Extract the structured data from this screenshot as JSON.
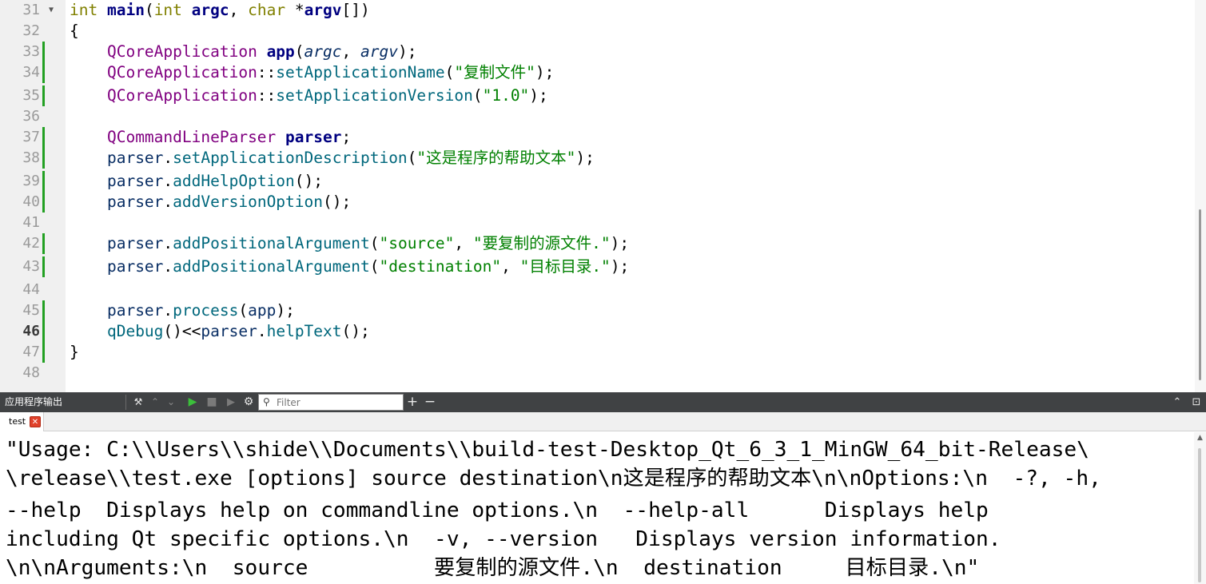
{
  "editor": {
    "lines": [
      {
        "n": "31",
        "fold": true,
        "segs": [
          [
            "int ",
            "k"
          ],
          [
            "main",
            "b"
          ],
          [
            "(",
            "p"
          ],
          [
            "int ",
            "k"
          ],
          [
            "argc",
            "b"
          ],
          [
            ", ",
            "p"
          ],
          [
            "char ",
            "k"
          ],
          [
            "*",
            "p"
          ],
          [
            "argv",
            "b"
          ],
          [
            "[])",
            "p"
          ]
        ]
      },
      {
        "n": "32",
        "segs": [
          [
            "{",
            "p"
          ]
        ]
      },
      {
        "n": "33",
        "changed": true,
        "segs": [
          [
            "    ",
            "p"
          ],
          [
            "QCoreApplication",
            "t"
          ],
          [
            " ",
            "p"
          ],
          [
            "app",
            "b"
          ],
          [
            "(",
            "p"
          ],
          [
            "argc",
            "i"
          ],
          [
            ", ",
            "p"
          ],
          [
            "argv",
            "i"
          ],
          [
            ");",
            "p"
          ]
        ]
      },
      {
        "n": "34",
        "changed": true,
        "segs": [
          [
            "    ",
            "p"
          ],
          [
            "QCoreApplication",
            "t"
          ],
          [
            "::",
            "p"
          ],
          [
            "setApplicationName",
            "f"
          ],
          [
            "(",
            "p"
          ],
          [
            "\"复制文件\"",
            "s"
          ],
          [
            ");",
            "p"
          ]
        ]
      },
      {
        "n": "35",
        "changed": true,
        "segs": [
          [
            "    ",
            "p"
          ],
          [
            "QCoreApplication",
            "t"
          ],
          [
            "::",
            "p"
          ],
          [
            "setApplicationVersion",
            "f"
          ],
          [
            "(",
            "p"
          ],
          [
            "\"1.0\"",
            "s"
          ],
          [
            ");",
            "p"
          ]
        ]
      },
      {
        "n": "36",
        "segs": []
      },
      {
        "n": "37",
        "changed": true,
        "segs": [
          [
            "    ",
            "p"
          ],
          [
            "QCommandLineParser",
            "t"
          ],
          [
            " ",
            "p"
          ],
          [
            "parser",
            "b"
          ],
          [
            ";",
            "p"
          ]
        ]
      },
      {
        "n": "38",
        "changed": true,
        "segs": [
          [
            "    ",
            "p"
          ],
          [
            "parser",
            "v"
          ],
          [
            ".",
            "p"
          ],
          [
            "setApplicationDescription",
            "f"
          ],
          [
            "(",
            "p"
          ],
          [
            "\"这是程序的帮助文本\"",
            "s"
          ],
          [
            ");",
            "p"
          ]
        ]
      },
      {
        "n": "39",
        "changed": true,
        "segs": [
          [
            "    ",
            "p"
          ],
          [
            "parser",
            "v"
          ],
          [
            ".",
            "p"
          ],
          [
            "addHelpOption",
            "f"
          ],
          [
            "();",
            "p"
          ]
        ]
      },
      {
        "n": "40",
        "changed": true,
        "segs": [
          [
            "    ",
            "p"
          ],
          [
            "parser",
            "v"
          ],
          [
            ".",
            "p"
          ],
          [
            "addVersionOption",
            "f"
          ],
          [
            "();",
            "p"
          ]
        ]
      },
      {
        "n": "41",
        "segs": []
      },
      {
        "n": "42",
        "changed": true,
        "segs": [
          [
            "    ",
            "p"
          ],
          [
            "parser",
            "v"
          ],
          [
            ".",
            "p"
          ],
          [
            "addPositionalArgument",
            "f"
          ],
          [
            "(",
            "p"
          ],
          [
            "\"source\"",
            "s"
          ],
          [
            ", ",
            "p"
          ],
          [
            "\"要复制的源文件.\"",
            "s"
          ],
          [
            ");",
            "p"
          ]
        ]
      },
      {
        "n": "43",
        "changed": true,
        "segs": [
          [
            "    ",
            "p"
          ],
          [
            "parser",
            "v"
          ],
          [
            ".",
            "p"
          ],
          [
            "addPositionalArgument",
            "f"
          ],
          [
            "(",
            "p"
          ],
          [
            "\"destination\"",
            "s"
          ],
          [
            ", ",
            "p"
          ],
          [
            "\"目标目录.\"",
            "s"
          ],
          [
            ");",
            "p"
          ]
        ]
      },
      {
        "n": "44",
        "segs": []
      },
      {
        "n": "45",
        "changed": true,
        "segs": [
          [
            "    ",
            "p"
          ],
          [
            "parser",
            "v"
          ],
          [
            ".",
            "p"
          ],
          [
            "process",
            "f"
          ],
          [
            "(",
            "p"
          ],
          [
            "app",
            "v"
          ],
          [
            ");",
            "p"
          ]
        ]
      },
      {
        "n": "46",
        "current": true,
        "changed": true,
        "segs": [
          [
            "    ",
            "p"
          ],
          [
            "qDebug",
            "f"
          ],
          [
            "()<<",
            "p"
          ],
          [
            "parser",
            "v"
          ],
          [
            ".",
            "p"
          ],
          [
            "helpText",
            "f"
          ],
          [
            "();",
            "p"
          ]
        ]
      },
      {
        "n": "47",
        "changed": true,
        "segs": [
          [
            "}",
            "p"
          ]
        ]
      },
      {
        "n": "48",
        "segs": []
      }
    ]
  },
  "output_pane": {
    "title": "应用程序输出",
    "toolbar_icons": [
      "attach-debugger-icon",
      "chevron-up-icon",
      "chevron-down-icon",
      "run-icon",
      "stop-icon",
      "debug-run-icon",
      "settings-icon"
    ],
    "filter": {
      "placeholder": "Filter",
      "value": ""
    },
    "add_label": "+",
    "remove_label": "−",
    "maximize_label": "⌃",
    "close_label": "⊡",
    "tab": {
      "label": "test",
      "close": "✕"
    },
    "output_lines": [
      "\"Usage: C:\\\\Users\\\\shide\\\\Documents\\\\build-test-Desktop_Qt_6_3_1_MinGW_64_bit-Release\\",
      "\\release\\\\test.exe [options] source destination\\n这是程序的帮助文本\\n\\nOptions:\\n  -?, -h,",
      "--help  Displays help on commandline options.\\n  --help-all      Displays help",
      "including Qt specific options.\\n  -v, --version   Displays version information.",
      "\\n\\nArguments:\\n  source          要复制的源文件.\\n  destination     目标目录.\\n\""
    ]
  },
  "colors": {
    "keyword": "#808000",
    "type": "#800080",
    "function": "#00677c",
    "string": "#008000",
    "declaration": "#000080",
    "changed_marker": "#22a022",
    "toolbar_bg": "#404244",
    "tab_close": "#e0412a"
  }
}
